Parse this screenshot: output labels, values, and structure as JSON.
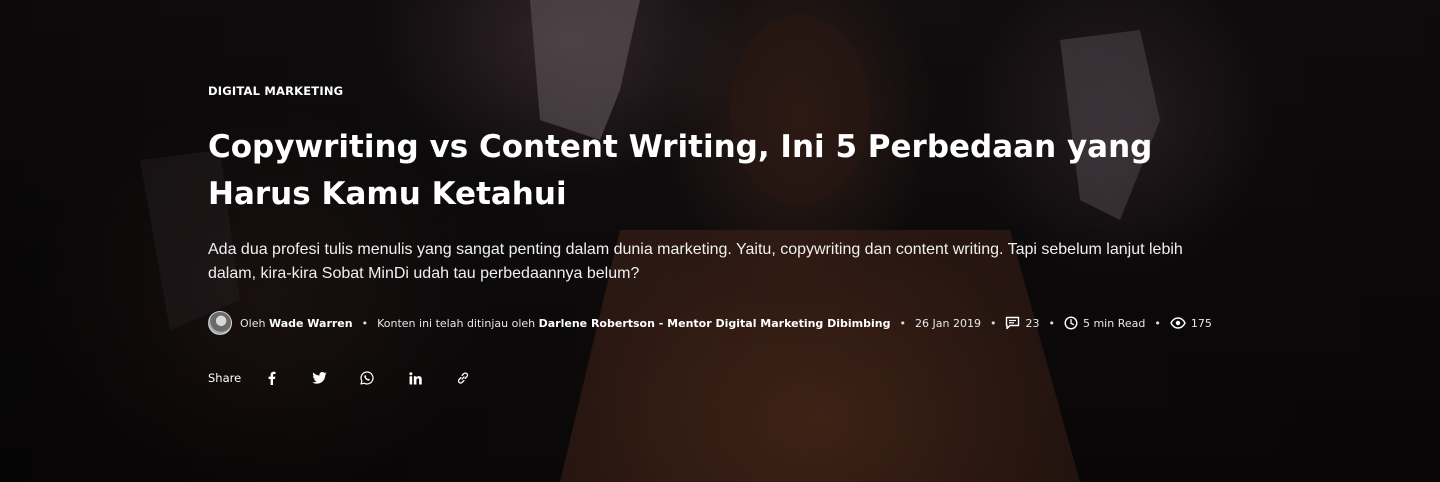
{
  "article": {
    "category": "DIGITAL MARKETING",
    "title": "Copywriting vs Content Writing, Ini 5 Perbedaan yang Harus Kamu Ketahui",
    "excerpt": "Ada dua profesi tulis menulis yang sangat penting dalam dunia marketing. Yaitu, copywriting dan content writing. Tapi sebelum lanjut lebih dalam, kira-kira Sobat MinDi udah tau perbedaannya belum?"
  },
  "meta": {
    "by_prefix": "Oleh",
    "author": "Wade Warren",
    "reviewed_prefix": "Konten ini telah ditinjau oleh",
    "reviewer": "Darlene Robertson - Mentor Digital Marketing Dibimbing",
    "date": "26 Jan 2019",
    "comments": "23",
    "read_time": "5 min Read",
    "views": "175",
    "separator": "•"
  },
  "share": {
    "label": "Share",
    "icons": [
      "facebook-icon",
      "twitter-icon",
      "whatsapp-icon",
      "linkedin-icon",
      "link-icon"
    ]
  }
}
